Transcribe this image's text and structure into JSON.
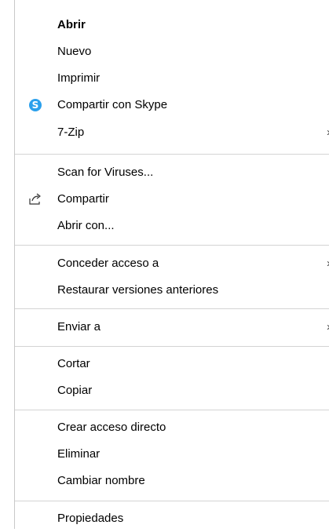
{
  "menu": {
    "items": [
      {
        "label": "Abrir"
      },
      {
        "label": "Nuevo"
      },
      {
        "label": "Imprimir"
      },
      {
        "label": "Compartir con Skype",
        "icon": "skype-icon"
      },
      {
        "label": "7-Zip",
        "submenu": true
      },
      {
        "label": "Scan for Viruses..."
      },
      {
        "label": "Compartir",
        "icon": "share-icon"
      },
      {
        "label": "Abrir con..."
      },
      {
        "label": "Conceder acceso a",
        "submenu": true
      },
      {
        "label": "Restaurar versiones anteriores"
      },
      {
        "label": "Enviar a",
        "submenu": true
      },
      {
        "label": "Cortar"
      },
      {
        "label": "Copiar"
      },
      {
        "label": "Crear acceso directo"
      },
      {
        "label": "Eliminar"
      },
      {
        "label": "Cambiar nombre"
      },
      {
        "label": "Propiedades"
      }
    ],
    "skype_glyph": "S",
    "submenu_glyph": "›"
  },
  "colors": {
    "skype": "#2ba0ec",
    "separator": "#d4d4d4"
  }
}
